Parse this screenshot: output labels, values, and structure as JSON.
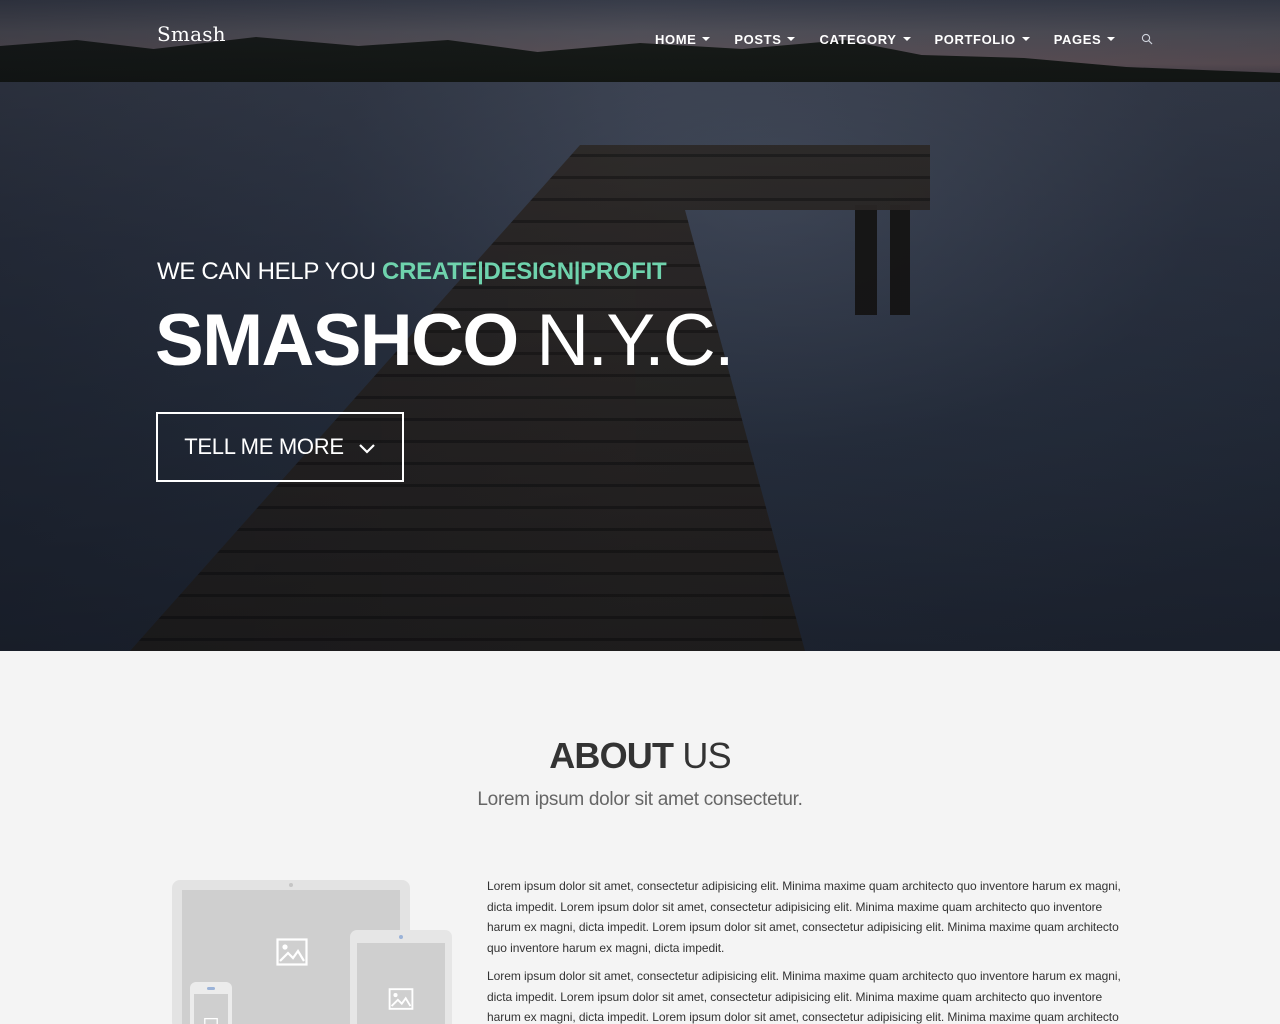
{
  "header": {
    "logo": "Smash",
    "nav": [
      {
        "label": "HOME"
      },
      {
        "label": "POSTS"
      },
      {
        "label": "CATEGORY"
      },
      {
        "label": "PORTFOLIO"
      },
      {
        "label": "PAGES"
      }
    ],
    "search_icon": "search-icon"
  },
  "hero": {
    "tagline_prefix": "WE CAN HELP YOU ",
    "tagline_accent": "CREATE|DESIGN|PROFIT",
    "headline_bold": "SMASHCO",
    "headline_light": " N.Y.C.",
    "cta_label": "TELL ME MORE",
    "cta_icon": "chevron-down-icon"
  },
  "about": {
    "title_bold": "ABOUT",
    "title_light": " US",
    "subtitle": "Lorem ipsum dolor sit amet consectetur.",
    "paragraph1": "Lorem ipsum dolor sit amet, consectetur adipisicing elit. Minima maxime quam architecto quo inventore harum ex magni, dicta impedit. Lorem ipsum dolor sit amet, consectetur adipisicing elit. Minima maxime quam architecto quo inventore harum ex magni, dicta impedit. Lorem ipsum dolor sit amet, consectetur adipisicing elit. Minima maxime quam architecto quo inventore harum ex magni, dicta impedit.",
    "paragraph2": "Lorem ipsum dolor sit amet, consectetur adipisicing elit. Minima maxime quam architecto quo inventore harum ex magni, dicta impedit. Lorem ipsum dolor sit amet, consectetur adipisicing elit. Minima maxime quam architecto quo inventore harum ex magni, dicta impedit. Lorem ipsum dolor sit amet, consectetur adipisicing elit. Minima maxime quam architecto quo"
  },
  "colors": {
    "accent": "#6fd3ad",
    "section_bg": "#f4f4f4",
    "text_dark": "#333333"
  }
}
